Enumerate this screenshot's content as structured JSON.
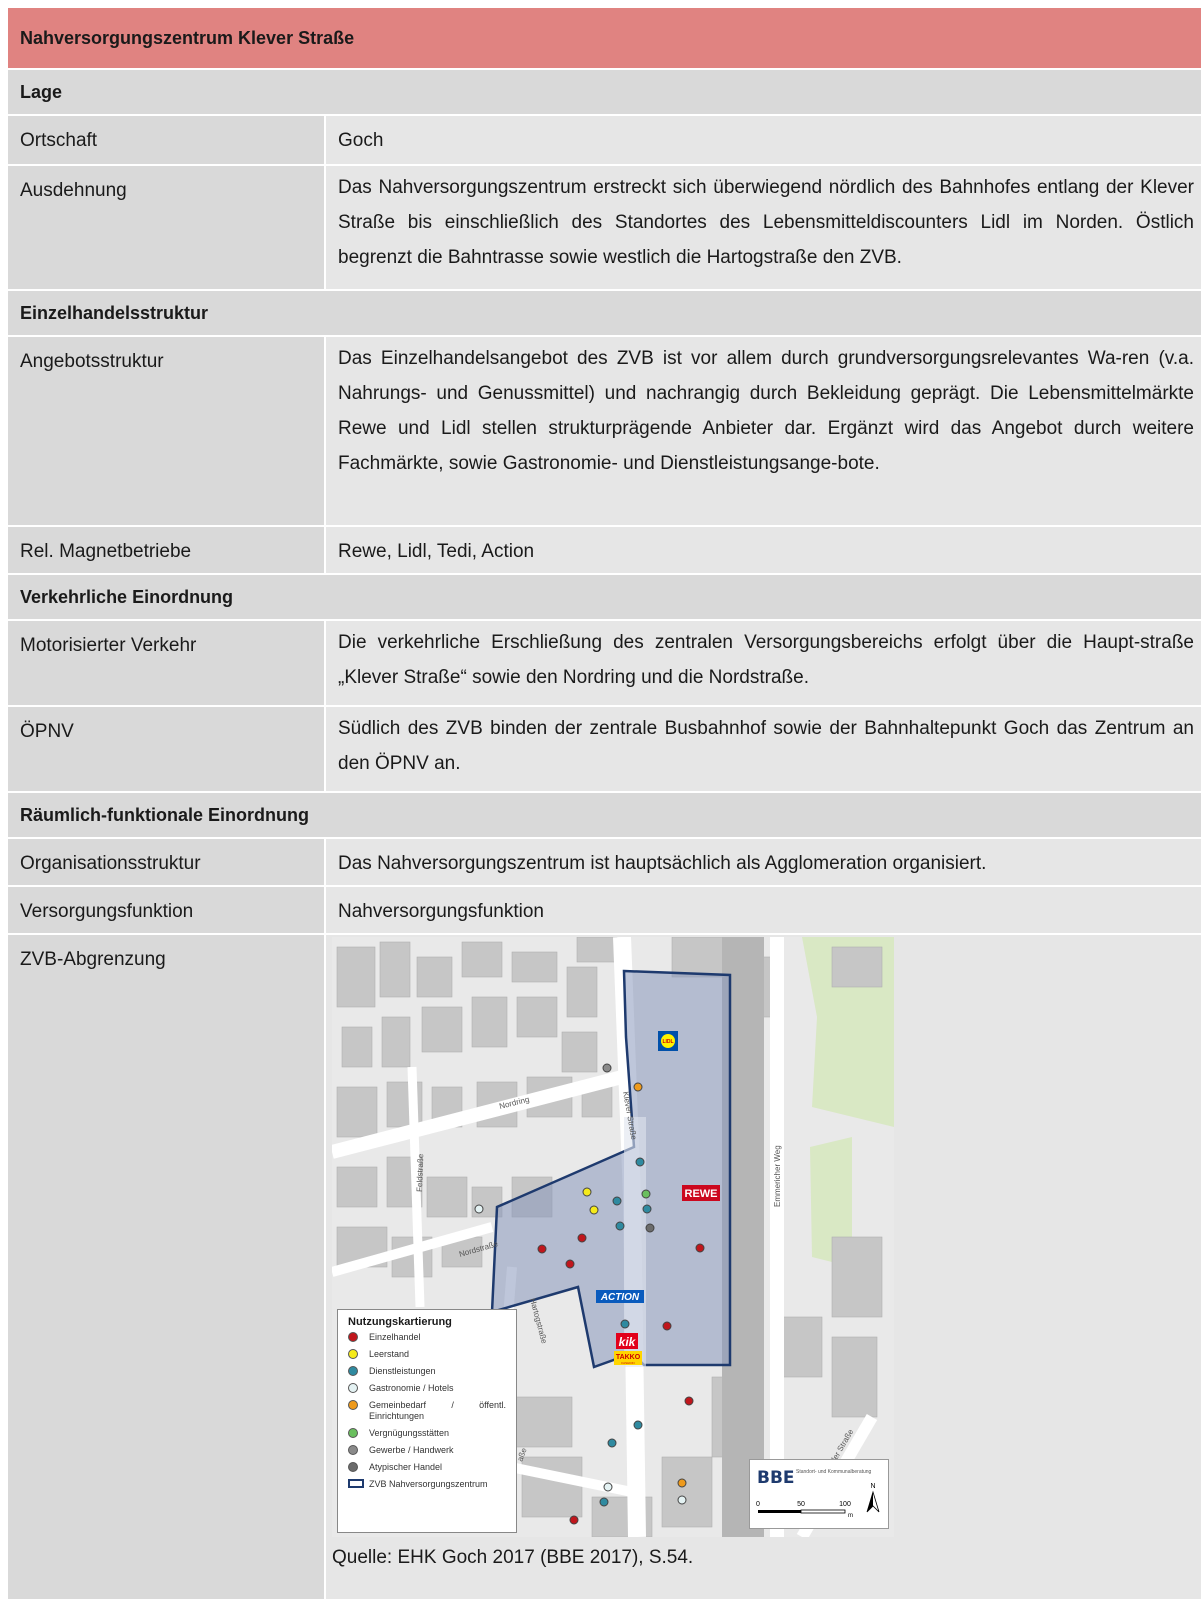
{
  "title": "Nahversorgungszentrum Klever Straße",
  "sections": {
    "lage": "Lage",
    "einzelhandel": "Einzelhandelsstruktur",
    "verkehr": "Verkehrliche Einordnung",
    "raeumlich": "Räumlich-funktionale Einordnung"
  },
  "rows": {
    "ortschaft": {
      "label": "Ortschaft",
      "value": "Goch"
    },
    "ausdehnung": {
      "label": "Ausdehnung",
      "value": "Das Nahversorgungszentrum erstreckt sich überwiegend nördlich des Bahnhofes entlang der Klever Straße bis einschließlich des Standortes des Lebensmitteldiscounters Lidl im Norden. Östlich begrenzt die Bahntrasse sowie westlich die Hartogstraße den ZVB."
    },
    "angebot": {
      "label": "Angebotsstruktur",
      "value": "Das Einzelhandelsangebot des ZVB ist vor allem durch grundversorgungsrelevantes Wa-ren (v.a. Nahrungs- und Genussmittel) und nachrangig durch Bekleidung geprägt. Die Lebensmittelmärkte Rewe und Lidl stellen strukturprägende Anbieter dar. Ergänzt wird das Angebot durch weitere Fachmärkte, sowie Gastronomie- und Dienstleistungsange-bote."
    },
    "magnet": {
      "label": "Rel. Magnetbetriebe",
      "value": "Rewe, Lidl, Tedi, Action"
    },
    "mit": {
      "label": "Motorisierter Verkehr",
      "value": "Die verkehrliche Erschließung des zentralen Versorgungsbereichs erfolgt über die Haupt-straße „Klever Straße“ sowie den Nordring und die Nordstraße."
    },
    "oepnv": {
      "label": "ÖPNV",
      "value": "Südlich des ZVB binden der zentrale Busbahnhof sowie der Bahnhaltepunkt Goch das Zentrum an den ÖPNV an."
    },
    "org": {
      "label": "Organisationsstruktur",
      "value": "Das Nahversorgungszentrum ist hauptsächlich als Agglomeration organisiert."
    },
    "versorgung": {
      "label": "Versorgungsfunktion",
      "value": "Nahversorgungsfunktion"
    },
    "zvb": {
      "label": "ZVB-Abgrenzung",
      "source": "Quelle: EHK Goch 2017 (BBE 2017), S.54."
    }
  },
  "map": {
    "streets": {
      "nordring": "Nordring",
      "klever": "Klever Straße",
      "feldstrasse": "Feldstraße",
      "nordstrasse": "Nordstraße",
      "hartog": "Hartogstraße",
      "emmericher": "Emmericher Weg",
      "dorfer": "dorfer Straße",
      "asse": "aße"
    },
    "stores": {
      "lidl": "LIDL",
      "rewe": "REWE",
      "action": "ACTION",
      "kik": "kik",
      "takko": "TAKKO",
      "takko_sub": "FASHION"
    },
    "legend": {
      "title": "Nutzungskartierung",
      "items": [
        {
          "label": "Einzelhandel",
          "color": "#c0161c"
        },
        {
          "label": "Leerstand",
          "color": "#f5ea1a"
        },
        {
          "label": "Dienstleistungen",
          "color": "#2f8aa0"
        },
        {
          "label": "Gastronomie / Hotels",
          "color": "#e4f2f3"
        },
        {
          "label": "Gemeinbedarf / öffentl. Einrichtungen",
          "color": "#ee9a1c"
        },
        {
          "label": "Vergnügungsstätten",
          "color": "#6abf5e"
        },
        {
          "label": "Gewerbe / Handwerk",
          "color": "#8a8a8a"
        },
        {
          "label": "Atypischer Handel",
          "color": "#6b6b6b"
        }
      ],
      "boundary": "ZVB Nahversorgungszentrum"
    },
    "scale": {
      "brand": "BBE",
      "brand_sub": "Standort- und Kommunalberatung",
      "ticks": [
        "0",
        "50",
        "100"
      ],
      "unit": "m",
      "north": "N"
    },
    "colors": {
      "zvb_fill": "#8898bb",
      "zvb_stroke": "#1e3a6e",
      "building": "#c6c6c6",
      "ground": "#e9e9e9",
      "green": "#d9e8c4"
    }
  }
}
